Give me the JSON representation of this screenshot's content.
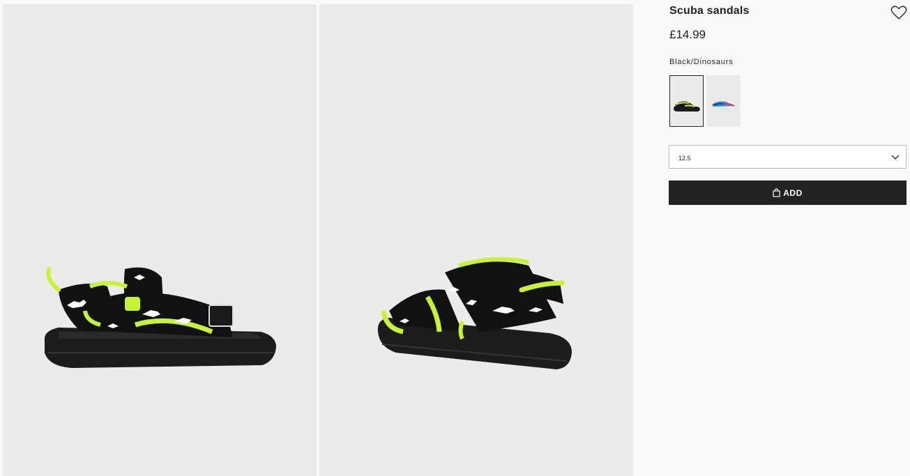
{
  "product": {
    "title": "Scuba sandals",
    "price": "£14.99",
    "color_name": "Black/Dinosaurs",
    "favorite_icon": "heart-icon"
  },
  "swatches": [
    {
      "name": "Black/Dinosaurs",
      "selected": true,
      "strap_color": "#1b1b1b",
      "accent_color": "#c6f432"
    },
    {
      "name": "Blue",
      "selected": false,
      "strap_color": "#2a8fd9",
      "accent_color": "#e23c3c"
    }
  ],
  "size_select": {
    "value": "12.5",
    "icon": "chevron-down-icon"
  },
  "add_button": {
    "label": "ADD",
    "icon": "shopping-bag-icon"
  },
  "colors": {
    "accent_green": "#c6f432",
    "button_bg": "#222222",
    "page_bg": "#faf9f8",
    "photo_bg": "#ecebea"
  }
}
